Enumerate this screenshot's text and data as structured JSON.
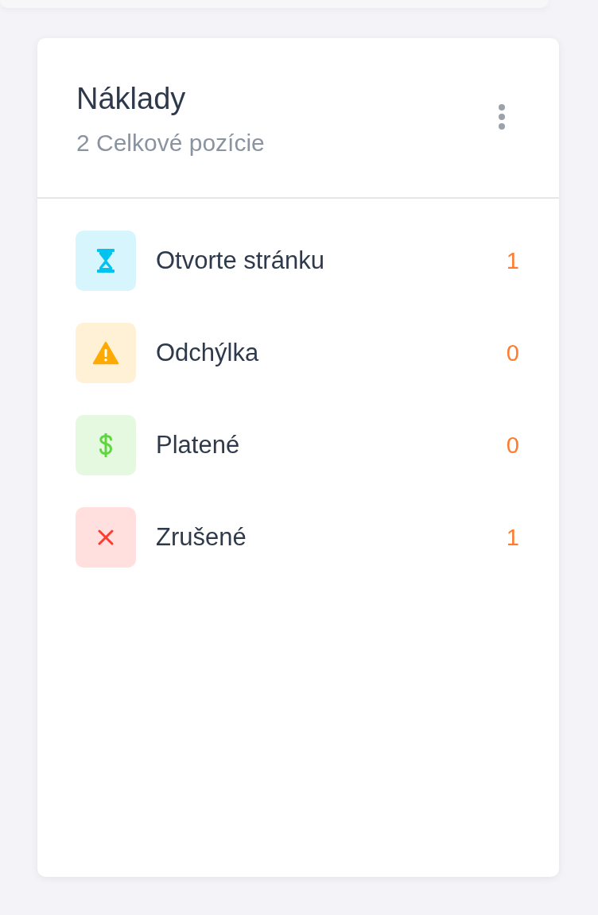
{
  "card": {
    "title": "Náklady",
    "subtitle": "2 Celkové pozície"
  },
  "items": [
    {
      "kind": "hourglass",
      "label": "Otvorte stránku",
      "count": "1",
      "color": "#00c3f0"
    },
    {
      "kind": "warning",
      "label": "Odchýlka",
      "count": "0",
      "color": "#ffaa00"
    },
    {
      "kind": "dollar",
      "label": "Platené",
      "count": "0",
      "color": "#5fd53f"
    },
    {
      "kind": "cross",
      "label": "Zrušené",
      "count": "1",
      "color": "#ff3b30"
    }
  ]
}
